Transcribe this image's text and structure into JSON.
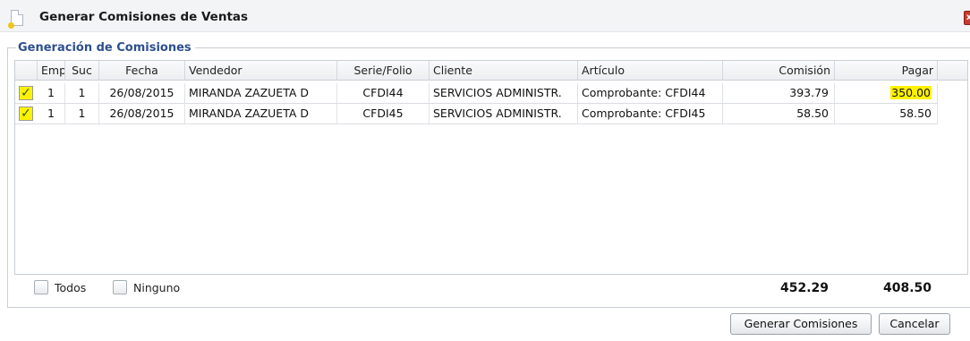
{
  "window": {
    "title": "Generar Comisiones de Ventas",
    "close_glyph": "x"
  },
  "group": {
    "legend": "Generación de Comisiones"
  },
  "table": {
    "columns": [
      "",
      "Emp",
      "Suc",
      "Fecha",
      "Vendedor",
      "Serie/Folio",
      "Cliente",
      "Artículo",
      "Comisión",
      "Pagar"
    ],
    "rows": [
      {
        "checked": true,
        "check_glyph": "✓",
        "emp": "1",
        "suc": "1",
        "fecha": "26/08/2015",
        "vendedor": "MIRANDA ZAZUETA D",
        "serie_folio": "CFDI44",
        "cliente": "SERVICIOS ADMINISTR.",
        "articulo": "Comprobante: CFDI44",
        "comision": "393.79",
        "pagar": "350.00"
      },
      {
        "checked": true,
        "check_glyph": "✓",
        "emp": "1",
        "suc": "1",
        "fecha": "26/08/2015",
        "vendedor": "MIRANDA ZAZUETA D",
        "serie_folio": "CFDI45",
        "cliente": "SERVICIOS ADMINISTR.",
        "articulo": "Comprobante: CFDI45",
        "comision": "58.50",
        "pagar": "58.50"
      }
    ],
    "highlight_color": "#fff200"
  },
  "footer": {
    "todos_label": "Todos",
    "ninguno_label": "Ninguno",
    "total_comision": "452.29",
    "total_pagar": "408.50"
  },
  "buttons": {
    "generar": "Generar Comisiones",
    "cancelar": "Cancelar"
  },
  "colors": {
    "legend": "#2e4f8e",
    "checkbox_checked": "#fff200"
  }
}
